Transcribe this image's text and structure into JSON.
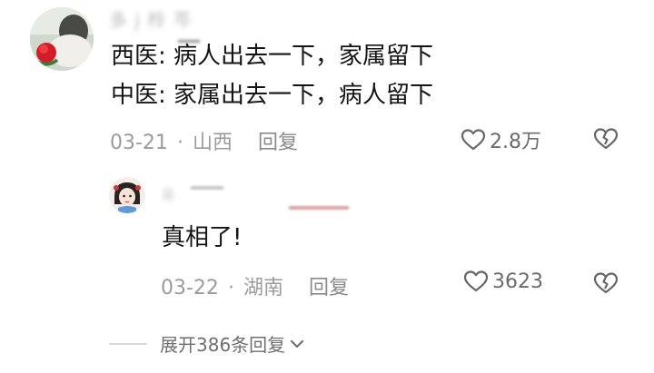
{
  "comment": {
    "username": "多 j 柃 芩",
    "lines": [
      "西医: 病人出去一下，家属留下",
      "中医: 家属出去一下，病人留下"
    ],
    "date": "03-21",
    "location": "山西",
    "reply_label": "回复",
    "likes": "2.8万"
  },
  "reply": {
    "username": "吴",
    "text": "真相了!",
    "date": "03-22",
    "location": "湖南",
    "reply_label": "回复",
    "likes": "3623"
  },
  "expand": {
    "label": "展开386条回复"
  },
  "icons": {
    "like": "heart-outline-icon",
    "dislike": "broken-heart-icon",
    "expand": "chevron-down-icon"
  }
}
